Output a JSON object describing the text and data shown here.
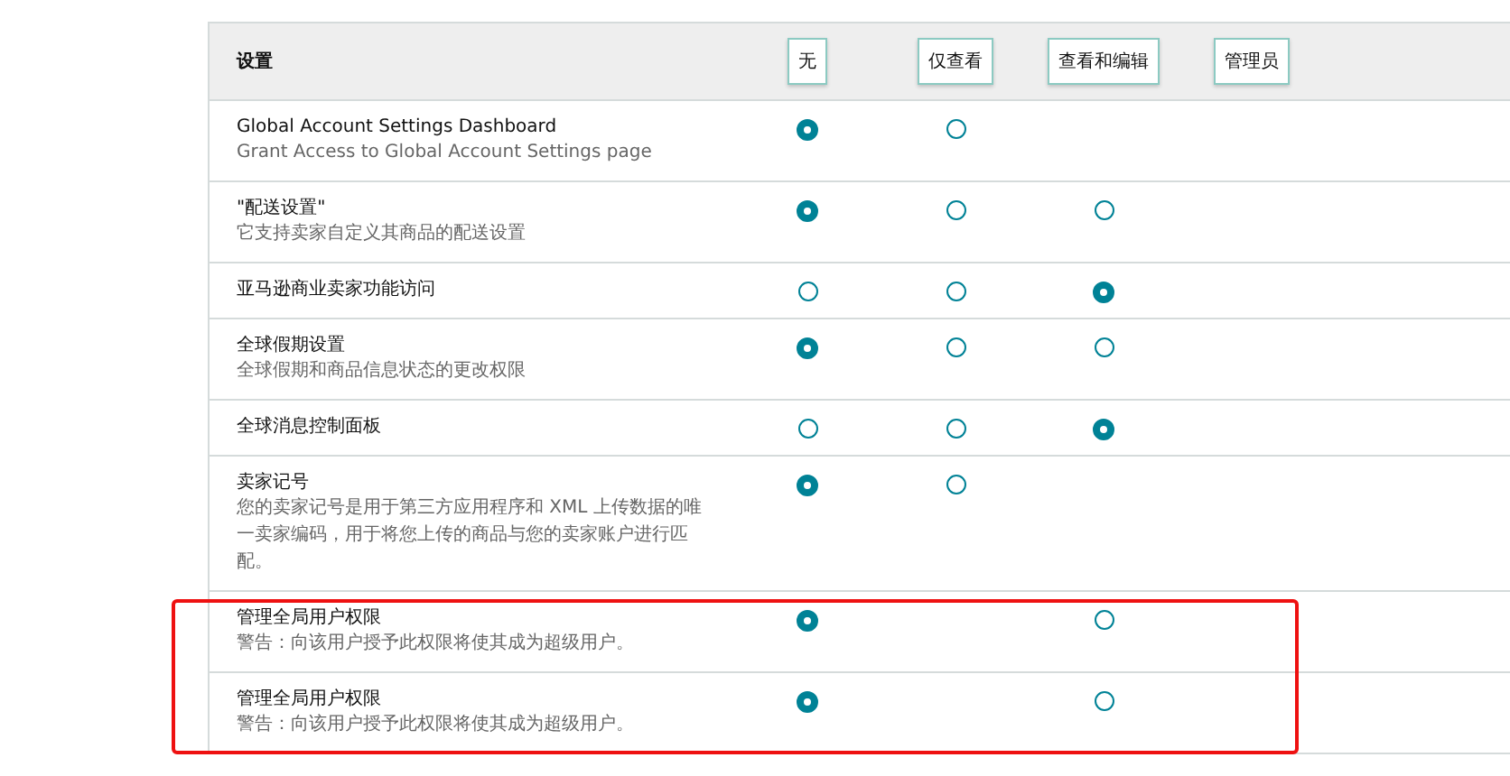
{
  "header": {
    "label": "设置",
    "buttons": [
      "无",
      "仅查看",
      "查看和编辑",
      "管理员"
    ]
  },
  "rows": [
    {
      "title": "Global Account Settings Dashboard",
      "description": "Grant Access to Global Account Settings page",
      "highlighted": false,
      "radios": [
        {
          "kind": "none",
          "selected": true
        },
        {
          "kind": "view",
          "selected": false
        }
      ]
    },
    {
      "title": "\"配送设置\"",
      "description": "它支持卖家自定义其商品的配送设置",
      "highlighted": false,
      "radios": [
        {
          "kind": "none",
          "selected": true
        },
        {
          "kind": "view",
          "selected": false
        },
        {
          "kind": "edit",
          "selected": false
        }
      ]
    },
    {
      "title": "亚马逊商业卖家功能访问",
      "highlighted": false,
      "radios": [
        {
          "kind": "none",
          "selected": false
        },
        {
          "kind": "view",
          "selected": false
        },
        {
          "kind": "edit",
          "selected": true
        }
      ]
    },
    {
      "title": "全球假期设置",
      "description": "全球假期和商品信息状态的更改权限",
      "highlighted": false,
      "radios": [
        {
          "kind": "none",
          "selected": true
        },
        {
          "kind": "view",
          "selected": false
        },
        {
          "kind": "edit",
          "selected": false
        }
      ]
    },
    {
      "title": "全球消息控制面板",
      "highlighted": false,
      "radios": [
        {
          "kind": "none",
          "selected": false
        },
        {
          "kind": "view",
          "selected": false
        },
        {
          "kind": "edit",
          "selected": true
        }
      ]
    },
    {
      "title": "卖家记号",
      "description": "您的卖家记号是用于第三方应用程序和 XML 上传数据的唯一卖家编码，用于将您上传的商品与您的卖家账户进行匹配。",
      "highlighted": false,
      "radios": [
        {
          "kind": "none",
          "selected": true
        },
        {
          "kind": "view",
          "selected": false
        }
      ]
    },
    {
      "title": "管理全局用户权限",
      "description": "警告：向该用户授予此权限将使其成为超级用户。",
      "highlighted": true,
      "radios": [
        {
          "kind": "none",
          "selected": true
        },
        {
          "kind": "edit",
          "selected": false
        }
      ]
    },
    {
      "title": "管理全局用户权限",
      "description": "警告：向该用户授予此权限将使其成为超级用户。",
      "highlighted": true,
      "radios": [
        {
          "kind": "none",
          "selected": true
        },
        {
          "kind": "edit",
          "selected": false
        }
      ]
    }
  ]
}
